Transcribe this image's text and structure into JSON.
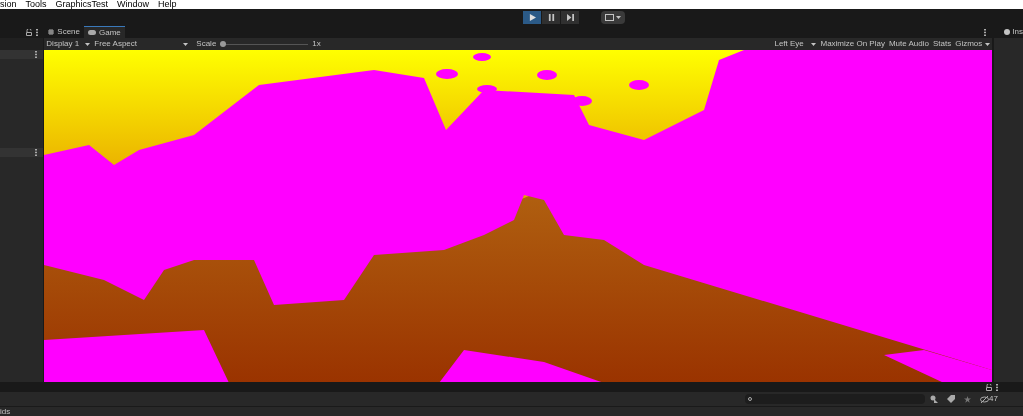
{
  "menu_bar": {
    "items": [
      "sion",
      "Tools",
      "GraphicsTest",
      "Window",
      "Help"
    ]
  },
  "play_controls": [
    {
      "kind": "play",
      "selected": true
    },
    {
      "kind": "pause",
      "selected": false
    },
    {
      "kind": "step",
      "selected": false
    }
  ],
  "view_tabs": [
    {
      "label": "Scene",
      "kind": "scene",
      "selected": false
    },
    {
      "label": "Game",
      "kind": "game",
      "selected": true
    }
  ],
  "game_toolbar": {
    "display": "Display 1",
    "aspect": "Free Aspect",
    "scale_label": "Scale",
    "scale": {
      "level": 0.0
    },
    "scale_value": "1x",
    "eye": "Left Eye",
    "toggles": [
      "Maximize On Play",
      "Mute Audio",
      "Stats",
      "Gizmos"
    ]
  },
  "inspector": {
    "title": "Ins"
  },
  "project_panel": {
    "hidden_count": "47",
    "footer_text": "ids"
  }
}
